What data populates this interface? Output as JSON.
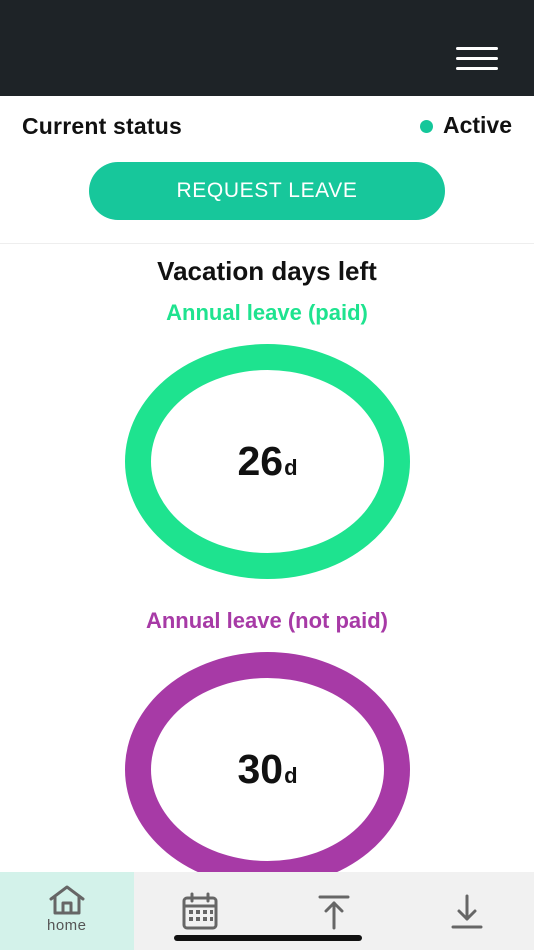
{
  "header": {
    "menu_icon": "hamburger-menu-icon",
    "background_color": "#1e2327"
  },
  "status": {
    "label": "Current status",
    "value": "Active",
    "dot_color": "#14c79a"
  },
  "request_button": {
    "label": "REQUEST LEAVE",
    "color": "#17c79b"
  },
  "vacation": {
    "title": "Vacation days left",
    "items": [
      {
        "label": "Annual leave (paid)",
        "days": "26",
        "unit": "d",
        "color": "#1ee38f"
      },
      {
        "label": "Annual leave (not paid)",
        "days": "30",
        "unit": "d",
        "color": "#a73aa6"
      }
    ]
  },
  "tabbar": {
    "tabs": [
      {
        "icon": "home-icon",
        "label": "home",
        "active": true
      },
      {
        "icon": "calendar-icon",
        "label": "",
        "active": false
      },
      {
        "icon": "upload-icon",
        "label": "",
        "active": false
      },
      {
        "icon": "download-icon",
        "label": "",
        "active": false
      }
    ],
    "active_color": "#d3f2ea"
  }
}
